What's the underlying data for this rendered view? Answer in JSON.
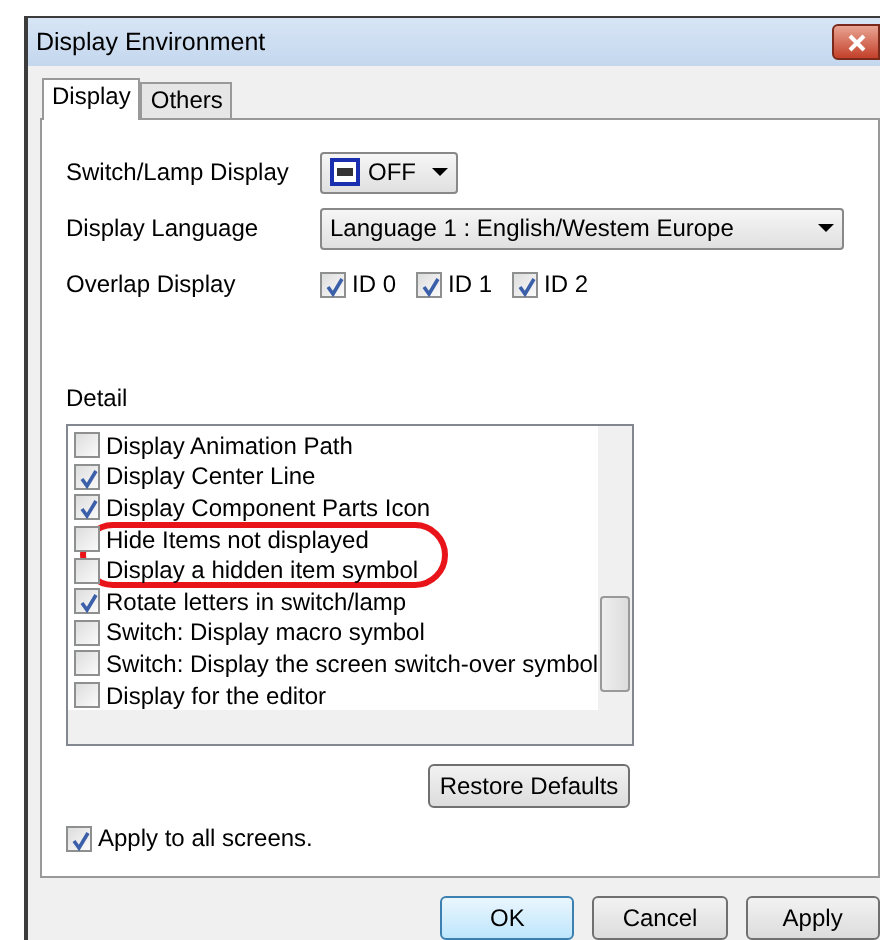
{
  "window": {
    "title": "Display Environment"
  },
  "tabs": [
    {
      "label": "Display",
      "selected": true
    },
    {
      "label": "Others",
      "selected": false
    }
  ],
  "settings": [
    {
      "kind": "switch",
      "label": "Switch/Lamp Display",
      "value": "OFF"
    },
    {
      "kind": "select",
      "label": "Display Language",
      "value": "Language 1 : English/Westem Europe"
    },
    {
      "kind": "checks",
      "label": "Overlap Display",
      "options": [
        {
          "label": "ID 0",
          "checked": true
        },
        {
          "label": "ID 1",
          "checked": true
        },
        {
          "label": "ID 2",
          "checked": true
        }
      ]
    }
  ],
  "detail": {
    "label": "Detail",
    "annotation": {
      "kind": "ellipse"
    },
    "items": [
      {
        "label": "Display Animation Path",
        "checked": false
      },
      {
        "label": "Display Center Line",
        "checked": true
      },
      {
        "label": "Display Component Parts Icon",
        "checked": true
      },
      {
        "label": "Hide Items not displayed",
        "checked": false
      },
      {
        "label": "Display a hidden item symbol",
        "checked": false
      },
      {
        "label": "Rotate letters in switch/lamp",
        "checked": true
      },
      {
        "label": "Switch: Display macro symbol",
        "checked": false
      },
      {
        "label": "Switch: Display the screen switch-over symbol",
        "checked": false
      },
      {
        "label": "Display for the editor",
        "checked": false
      }
    ]
  },
  "restore_button": "Restore Defaults",
  "apply_all": {
    "label": "Apply to all screens.",
    "checked": true
  },
  "buttons": [
    {
      "label": "OK",
      "default": true
    },
    {
      "label": "Cancel",
      "default": false
    },
    {
      "label": "Apply",
      "default": false
    }
  ]
}
